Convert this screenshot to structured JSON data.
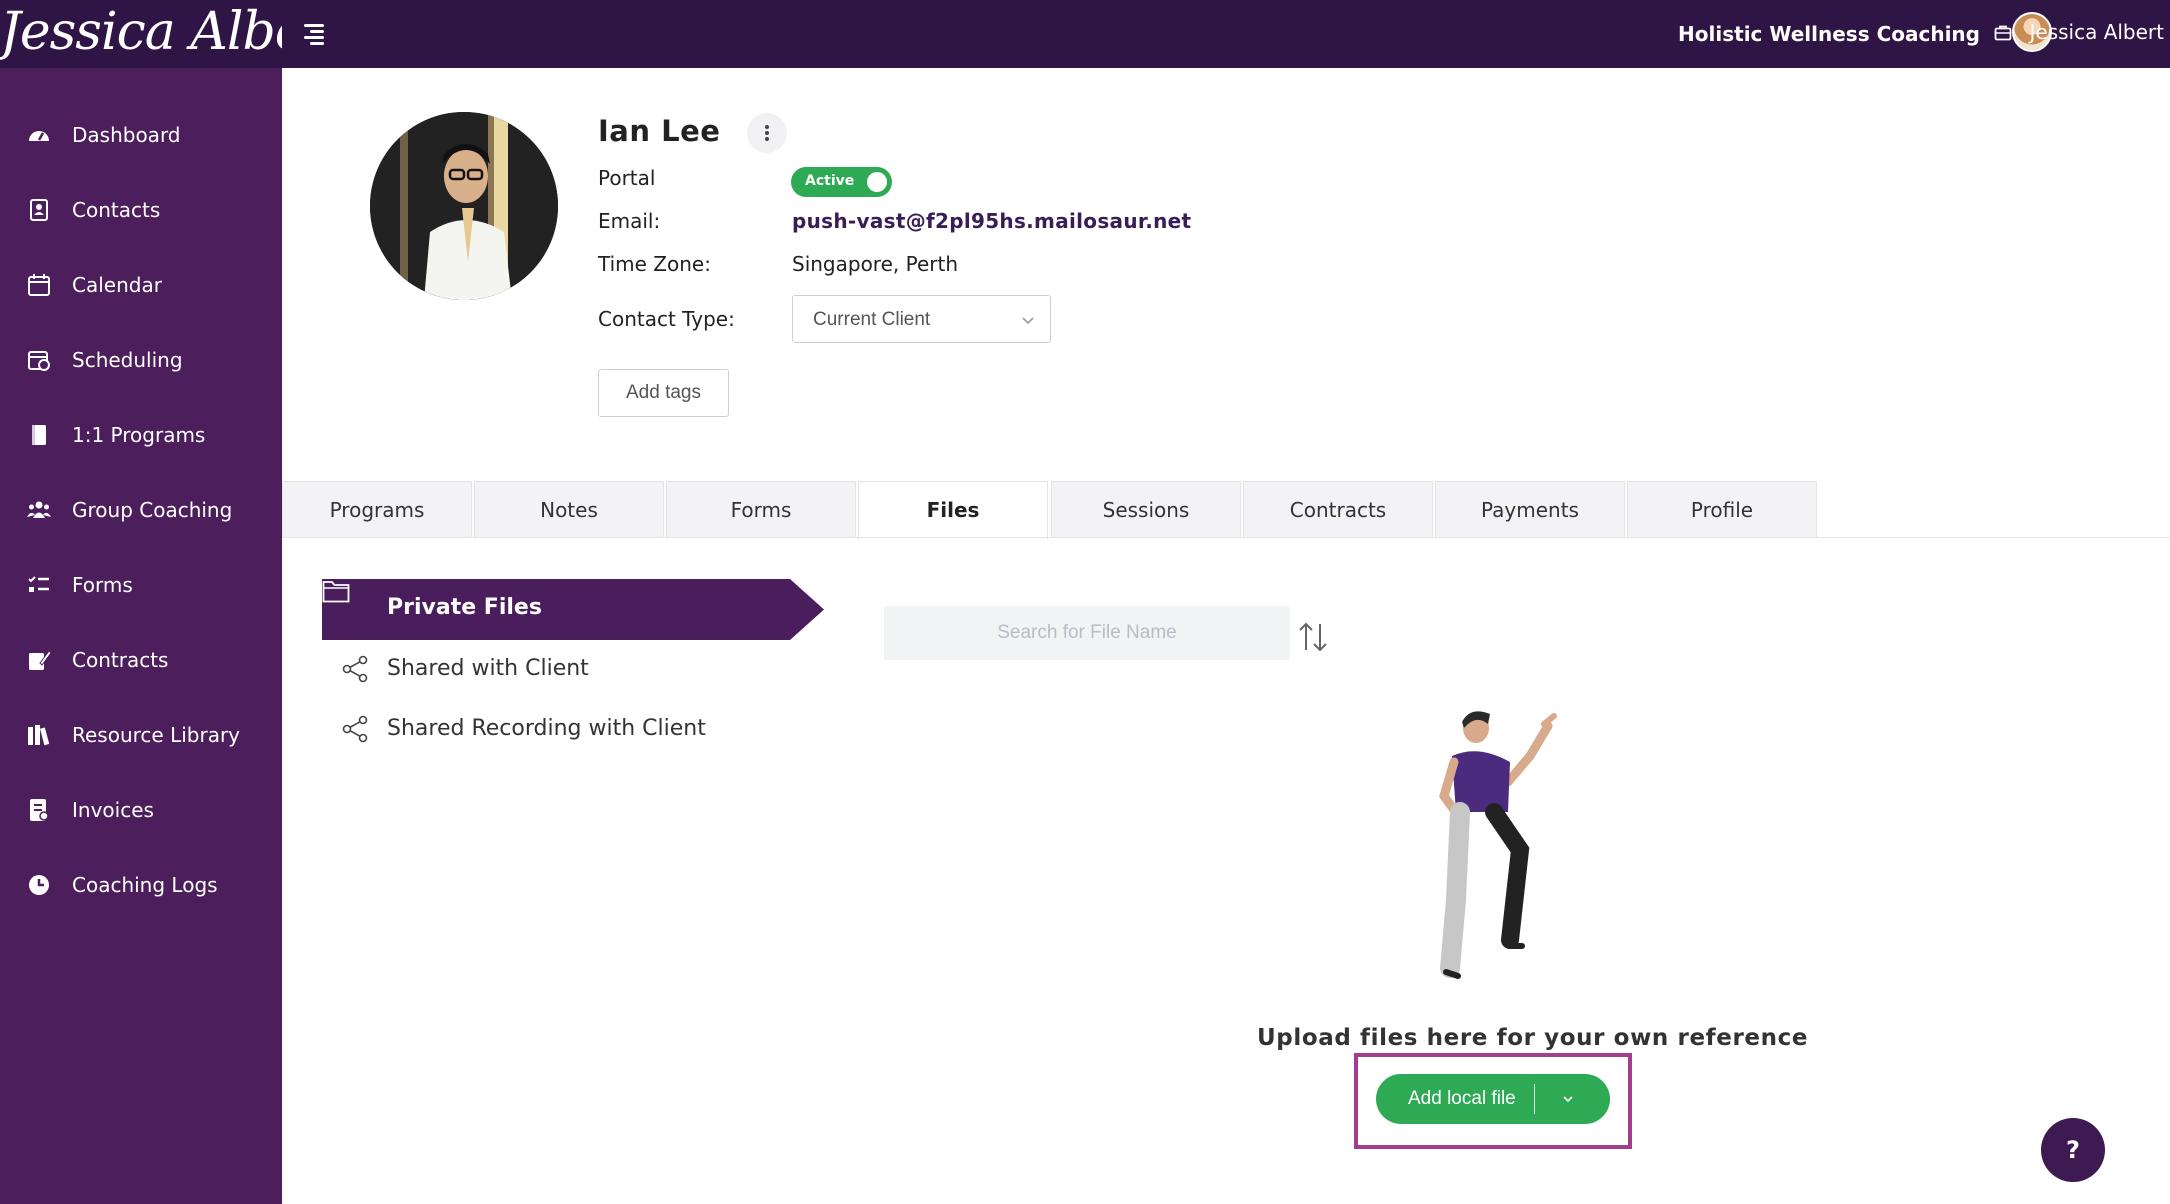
{
  "header": {
    "brand": "Jessica Albert",
    "business_name": "Holistic Wellness Coaching",
    "user_name": "Jessica Albert"
  },
  "sidebar": {
    "items": [
      {
        "label": "Dashboard",
        "icon": "dashboard-icon"
      },
      {
        "label": "Contacts",
        "icon": "contacts-icon"
      },
      {
        "label": "Calendar",
        "icon": "calendar-icon"
      },
      {
        "label": "Scheduling",
        "icon": "scheduling-icon"
      },
      {
        "label": "1:1 Programs",
        "icon": "book-icon"
      },
      {
        "label": "Group Coaching",
        "icon": "group-icon"
      },
      {
        "label": "Forms",
        "icon": "list-icon"
      },
      {
        "label": "Contracts",
        "icon": "sign-icon"
      },
      {
        "label": "Resource Library",
        "icon": "library-icon"
      },
      {
        "label": "Invoices",
        "icon": "invoice-icon"
      },
      {
        "label": "Coaching Logs",
        "icon": "clock-icon"
      }
    ]
  },
  "contact": {
    "name": "Ian Lee",
    "portal_label": "Portal",
    "portal_status": "Active",
    "email_label": "Email:",
    "email": "push-vast@f2pl95hs.mailosaur.net",
    "timezone_label": "Time Zone:",
    "timezone": "Singapore, Perth",
    "type_label": "Contact Type:",
    "type_value": "Current Client",
    "add_tags": "Add tags"
  },
  "tabs": [
    {
      "label": "Programs"
    },
    {
      "label": "Notes"
    },
    {
      "label": "Forms"
    },
    {
      "label": "Files",
      "active": true
    },
    {
      "label": "Sessions"
    },
    {
      "label": "Contracts"
    },
    {
      "label": "Payments"
    },
    {
      "label": "Profile"
    }
  ],
  "files": {
    "categories": [
      {
        "label": "Private Files",
        "active": true
      },
      {
        "label": "Shared with Client"
      },
      {
        "label": "Shared Recording with Client"
      }
    ],
    "search_placeholder": "Search for File Name",
    "empty_text": "Upload files here for your own reference",
    "add_button": "Add local file"
  },
  "help_label": "?",
  "colors": {
    "topbar": "#2e1545",
    "sidebar": "#4c1f5c",
    "accent": "#4a1d5c",
    "green": "#2eaa55",
    "highlight": "#a23d8f"
  }
}
